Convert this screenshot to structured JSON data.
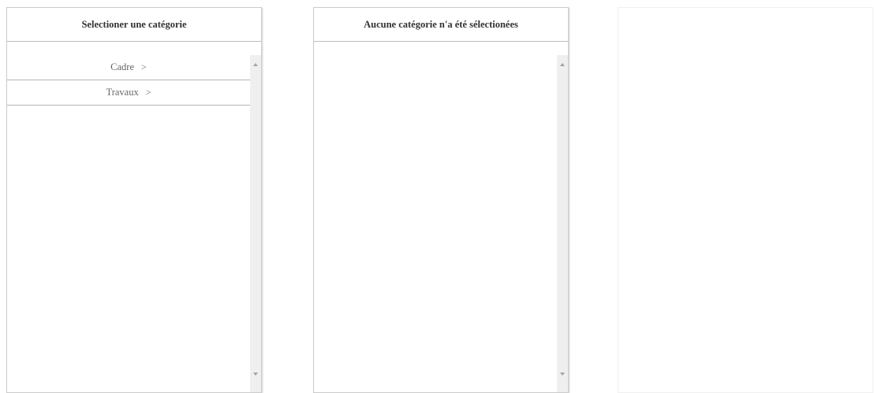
{
  "panels": [
    {
      "header": "Selectioner une catégorie",
      "items": [
        {
          "label": "Cadre",
          "chevron": ">"
        },
        {
          "label": "Travaux",
          "chevron": ">"
        }
      ]
    },
    {
      "header": "Aucune catégorie n'a été sélectionées",
      "items": []
    },
    {
      "header": "",
      "items": []
    }
  ],
  "colors": {
    "border": "#cccccc",
    "divider": "#b5b5b5",
    "scrollbar_track": "#efefef",
    "header_text": "#333333",
    "item_text": "#666666"
  },
  "icons": {
    "chevron": "chevron-right-icon",
    "scroll_up": "arrow-up-icon",
    "scroll_down": "arrow-down-icon"
  }
}
